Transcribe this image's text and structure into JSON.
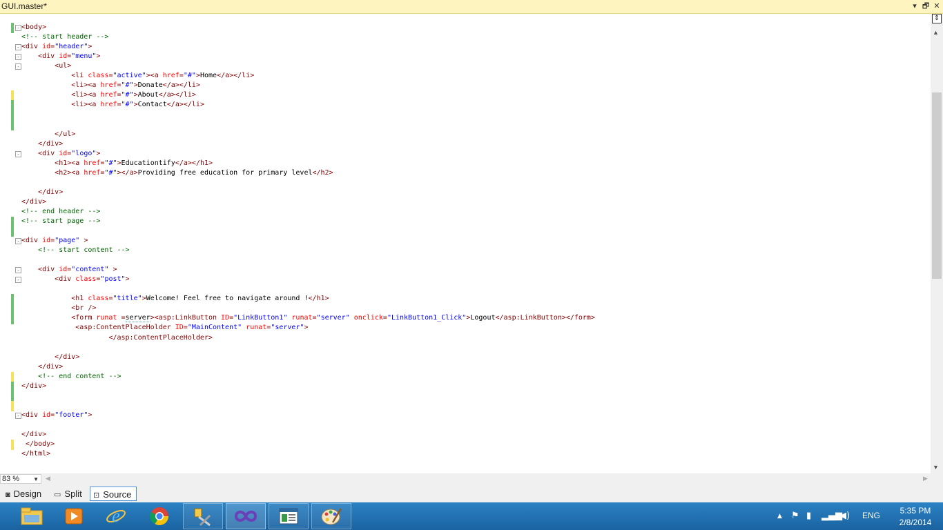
{
  "document_tab": {
    "title": "GUI.master*",
    "buttons": {
      "dropdown": "▾",
      "restore": "🗗",
      "close": "✕"
    }
  },
  "editor": {
    "code_lines": [
      {
        "fold": "-",
        "changed": "green",
        "tokens": [
          [
            "tag",
            "<body>"
          ]
        ]
      },
      {
        "tokens": [
          [
            "comment",
            "<!-- start header -->"
          ]
        ]
      },
      {
        "fold": "-",
        "tokens": [
          [
            "tag",
            "<div "
          ],
          [
            "attr",
            "id"
          ],
          [
            "tag",
            "="
          ],
          [
            "val",
            "\"header\""
          ],
          [
            "tag",
            ">"
          ]
        ]
      },
      {
        "fold": "-",
        "tokens": [
          [
            "text",
            "    "
          ],
          [
            "tag",
            "<div "
          ],
          [
            "attr",
            "id"
          ],
          [
            "tag",
            "="
          ],
          [
            "val",
            "\"menu\""
          ],
          [
            "tag",
            ">"
          ]
        ]
      },
      {
        "fold": "-",
        "tokens": [
          [
            "text",
            "        "
          ],
          [
            "tag",
            "<ul>"
          ]
        ]
      },
      {
        "tokens": [
          [
            "text",
            "            "
          ],
          [
            "tag",
            "<li "
          ],
          [
            "attr",
            "class"
          ],
          [
            "tag",
            "="
          ],
          [
            "val",
            "\"active\""
          ],
          [
            "tag",
            "><a "
          ],
          [
            "attr",
            "href"
          ],
          [
            "tag",
            "="
          ],
          [
            "val",
            "\"#\""
          ],
          [
            "tag",
            ">"
          ],
          [
            "text",
            "Home"
          ],
          [
            "tag",
            "</a></li>"
          ]
        ]
      },
      {
        "tokens": [
          [
            "text",
            "            "
          ],
          [
            "tag",
            "<li><a "
          ],
          [
            "attr",
            "href"
          ],
          [
            "tag",
            "="
          ],
          [
            "val",
            "\"#\""
          ],
          [
            "tag",
            ">"
          ],
          [
            "text",
            "Donate"
          ],
          [
            "tag",
            "</a></li>"
          ]
        ]
      },
      {
        "changed": "yellow",
        "tokens": [
          [
            "text",
            "            "
          ],
          [
            "tag",
            "<li><a "
          ],
          [
            "attr",
            "href"
          ],
          [
            "tag",
            "="
          ],
          [
            "val",
            "\"#\""
          ],
          [
            "tag",
            ">"
          ],
          [
            "text",
            "About"
          ],
          [
            "tag",
            "</a></li>"
          ]
        ]
      },
      {
        "changed": "green",
        "tokens": [
          [
            "text",
            "            "
          ],
          [
            "tag",
            "<li><a "
          ],
          [
            "attr",
            "href"
          ],
          [
            "tag",
            "="
          ],
          [
            "val",
            "\"#\""
          ],
          [
            "tag",
            ">"
          ],
          [
            "text",
            "Contact"
          ],
          [
            "tag",
            "</a></li>"
          ]
        ]
      },
      {
        "changed": "green",
        "tokens": []
      },
      {
        "changed": "green",
        "tokens": []
      },
      {
        "tokens": [
          [
            "text",
            "        "
          ],
          [
            "tag",
            "</ul>"
          ]
        ]
      },
      {
        "tokens": [
          [
            "text",
            "    "
          ],
          [
            "tag",
            "</div>"
          ]
        ]
      },
      {
        "fold": "-",
        "tokens": [
          [
            "text",
            "    "
          ],
          [
            "tag",
            "<div "
          ],
          [
            "attr",
            "id"
          ],
          [
            "tag",
            "="
          ],
          [
            "val",
            "\"logo\""
          ],
          [
            "tag",
            ">"
          ]
        ]
      },
      {
        "tokens": [
          [
            "text",
            "        "
          ],
          [
            "tag",
            "<h1><a "
          ],
          [
            "attr",
            "href"
          ],
          [
            "tag",
            "="
          ],
          [
            "val",
            "\"#\""
          ],
          [
            "tag",
            ">"
          ],
          [
            "text",
            "Educationtify"
          ],
          [
            "tag",
            "</a></h1>"
          ]
        ]
      },
      {
        "tokens": [
          [
            "text",
            "        "
          ],
          [
            "tag",
            "<h2><a "
          ],
          [
            "attr",
            "href"
          ],
          [
            "tag",
            "="
          ],
          [
            "val",
            "\"#\""
          ],
          [
            "tag",
            "></a>"
          ],
          [
            "text",
            "Providing free education for primary level"
          ],
          [
            "tag",
            "</h2>"
          ]
        ]
      },
      {
        "tokens": []
      },
      {
        "tokens": [
          [
            "text",
            "    "
          ],
          [
            "tag",
            "</div>"
          ]
        ]
      },
      {
        "tokens": [
          [
            "tag",
            "</div>"
          ]
        ]
      },
      {
        "tokens": [
          [
            "comment",
            "<!-- end header -->"
          ]
        ]
      },
      {
        "changed": "green",
        "tokens": [
          [
            "comment",
            "<!-- start page -->"
          ]
        ]
      },
      {
        "changed": "green",
        "tokens": []
      },
      {
        "fold": "-",
        "tokens": [
          [
            "tag",
            "<div "
          ],
          [
            "attr",
            "id"
          ],
          [
            "tag",
            "="
          ],
          [
            "val",
            "\"page\""
          ],
          [
            "tag",
            " >"
          ]
        ]
      },
      {
        "tokens": [
          [
            "text",
            "    "
          ],
          [
            "comment",
            "<!-- start content -->"
          ]
        ]
      },
      {
        "tokens": []
      },
      {
        "fold": "-",
        "tokens": [
          [
            "text",
            "    "
          ],
          [
            "tag",
            "<div "
          ],
          [
            "attr",
            "id"
          ],
          [
            "tag",
            "="
          ],
          [
            "val",
            "\"content\""
          ],
          [
            "tag",
            " >"
          ]
        ]
      },
      {
        "fold": "-",
        "tokens": [
          [
            "text",
            "        "
          ],
          [
            "tag",
            "<div "
          ],
          [
            "attr",
            "class"
          ],
          [
            "tag",
            "="
          ],
          [
            "val",
            "\"post\""
          ],
          [
            "tag",
            ">"
          ]
        ]
      },
      {
        "tokens": []
      },
      {
        "changed": "green",
        "tokens": [
          [
            "text",
            "            "
          ],
          [
            "tag",
            "<h1 "
          ],
          [
            "attr",
            "class"
          ],
          [
            "tag",
            "="
          ],
          [
            "val",
            "\"title\""
          ],
          [
            "tag",
            ">"
          ],
          [
            "text",
            "Welcome! Feel free to navigate around !"
          ],
          [
            "tag",
            "</h1>"
          ]
        ]
      },
      {
        "changed": "green",
        "tokens": [
          [
            "text",
            "            "
          ],
          [
            "tag",
            "<br />"
          ]
        ]
      },
      {
        "changed": "green",
        "tokens": [
          [
            "text",
            "            "
          ],
          [
            "tag",
            "<form "
          ],
          [
            "attr",
            "runat"
          ],
          [
            "tag",
            " ="
          ],
          [
            "sq",
            "server"
          ],
          [
            "tag",
            "><asp:LinkButton "
          ],
          [
            "attr",
            "ID"
          ],
          [
            "tag",
            "="
          ],
          [
            "val",
            "\"LinkButton1\""
          ],
          [
            "tag",
            " "
          ],
          [
            "attr",
            "runat"
          ],
          [
            "tag",
            "="
          ],
          [
            "val",
            "\"server\""
          ],
          [
            "tag",
            " "
          ],
          [
            "attr",
            "onclick"
          ],
          [
            "tag",
            "="
          ],
          [
            "val",
            "\"LinkButton1_Click\""
          ],
          [
            "tag",
            ">"
          ],
          [
            "text",
            "Logout"
          ],
          [
            "tag",
            "</asp:LinkButton></form>"
          ]
        ]
      },
      {
        "tokens": [
          [
            "text",
            "             "
          ],
          [
            "tag",
            "<asp:ContentPlaceHolder "
          ],
          [
            "attr",
            "ID"
          ],
          [
            "tag",
            "="
          ],
          [
            "val",
            "\"MainContent\""
          ],
          [
            "tag",
            " "
          ],
          [
            "attr",
            "runat"
          ],
          [
            "tag",
            "="
          ],
          [
            "val",
            "\"server\""
          ],
          [
            "tag",
            ">"
          ]
        ]
      },
      {
        "tokens": [
          [
            "text",
            "                     "
          ],
          [
            "tag",
            "</asp:ContentPlaceHolder>"
          ]
        ]
      },
      {
        "tokens": []
      },
      {
        "tokens": [
          [
            "text",
            "        "
          ],
          [
            "tag",
            "</div>"
          ]
        ]
      },
      {
        "tokens": [
          [
            "text",
            "    "
          ],
          [
            "tag",
            "</div>"
          ]
        ]
      },
      {
        "changed": "yellow",
        "tokens": [
          [
            "text",
            "    "
          ],
          [
            "comment",
            "<!-- end content -->"
          ]
        ]
      },
      {
        "changed": "green",
        "tokens": [
          [
            "tag",
            "</div>"
          ]
        ]
      },
      {
        "changed": "green",
        "tokens": []
      },
      {
        "changed": "yellow",
        "tokens": []
      },
      {
        "fold": "-",
        "tokens": [
          [
            "tag",
            "<div "
          ],
          [
            "attr",
            "id"
          ],
          [
            "tag",
            "="
          ],
          [
            "val",
            "\"footer\""
          ],
          [
            "tag",
            ">"
          ]
        ]
      },
      {
        "tokens": []
      },
      {
        "tokens": [
          [
            "tag",
            "</div>"
          ]
        ]
      },
      {
        "changed": "yellow",
        "tokens": [
          [
            "text",
            " "
          ],
          [
            "tag",
            "</body>"
          ]
        ]
      },
      {
        "tokens": [
          [
            "tag",
            "</html>"
          ]
        ]
      }
    ]
  },
  "zoom": {
    "value": "83 %"
  },
  "view_tabs": [
    {
      "label": "Design",
      "icon": "design-icon",
      "glyph": "◙"
    },
    {
      "label": "Split",
      "icon": "split-icon",
      "glyph": "▭"
    },
    {
      "label": "Source",
      "icon": "source-icon",
      "glyph": "⊡",
      "selected": true
    }
  ],
  "taskbar": {
    "apps": [
      {
        "name": "file-explorer",
        "active": false
      },
      {
        "name": "media-player",
        "active": false
      },
      {
        "name": "internet-explorer",
        "active": false
      },
      {
        "name": "chrome",
        "active": false
      },
      {
        "name": "sql-tool",
        "active": false,
        "running": true
      },
      {
        "name": "visual-studio",
        "active": true
      },
      {
        "name": "window-app",
        "active": false,
        "running": true
      },
      {
        "name": "paint",
        "active": false,
        "running": true
      }
    ],
    "tray": {
      "language": "ENG",
      "time": "5:35 PM",
      "date": "2/8/2014"
    }
  },
  "colors": {
    "tag": "#800000",
    "attr": "#ff0000",
    "value": "#0000ff",
    "comment": "#006400",
    "change_green": "#6cc070",
    "change_yellow": "#f7e15c",
    "taskbar": "#1f6fae"
  }
}
